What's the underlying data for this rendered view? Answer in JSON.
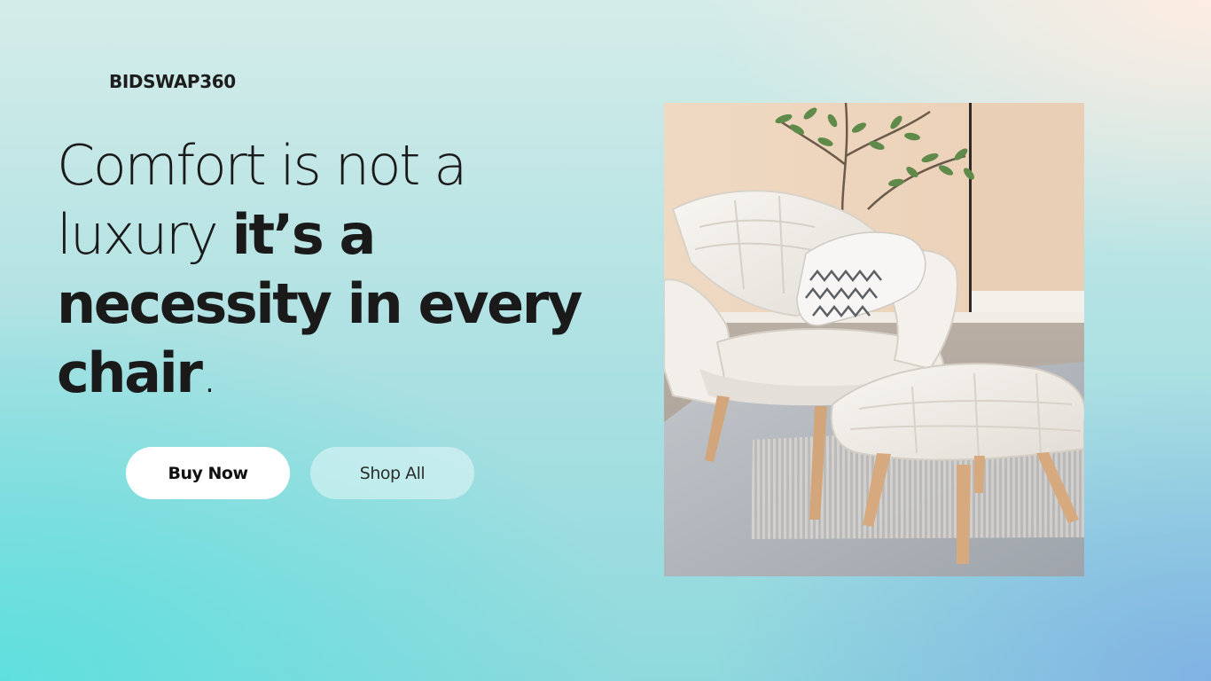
{
  "brand": {
    "name": "BIDSWAP360"
  },
  "hero": {
    "headline_light_1": "Comfort is not a",
    "headline_light_2": "luxury ",
    "headline_bold_1": "it’s a",
    "headline_bold_2": "necessity in every",
    "headline_bold_3": "chair",
    "headline_period": "."
  },
  "actions": {
    "buy_label": "Buy Now",
    "shop_label": "Shop All"
  },
  "image": {
    "alt": "Product photo"
  },
  "colors": {
    "text": "#1a1a1a",
    "button_primary_bg": "#ffffff",
    "bg_teal": "#5ce0de",
    "bg_peach": "#ffece2",
    "bg_blue": "#80b0e4"
  }
}
